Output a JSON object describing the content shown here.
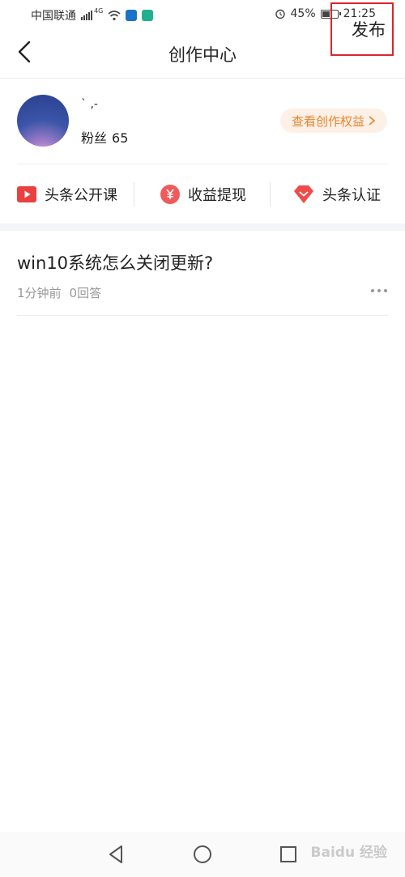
{
  "status_bar": {
    "carrier": "中国联通",
    "network": "4G",
    "battery_percent": "45%",
    "battery_level": 0.45,
    "time": "21:25",
    "icons": [
      "signal-icon",
      "wifi-icon",
      "shield-app-icon",
      "app-icon",
      "alarm-icon",
      "battery-icon"
    ]
  },
  "header": {
    "title": "创作中心",
    "publish_label": "发布",
    "highlight_color": "#d9252e"
  },
  "profile": {
    "username": "` ,-",
    "fans_label": "粉丝",
    "fans_count": "65",
    "rights_button": "查看创作权益",
    "rights_color": "#e8842e"
  },
  "quick_links": [
    {
      "label": "头条公开课",
      "icon": "play-icon",
      "color": "#e94040"
    },
    {
      "label": "收益提现",
      "icon": "yuan-icon",
      "color": "#f05a5a"
    },
    {
      "label": "头条认证",
      "icon": "diamond-icon",
      "color": "#f04a4a"
    }
  ],
  "articles": [
    {
      "title": "win10系统怎么关闭更新?",
      "time": "1分钟前",
      "answers": "0回答"
    }
  ],
  "watermark": "Baidu 经验"
}
